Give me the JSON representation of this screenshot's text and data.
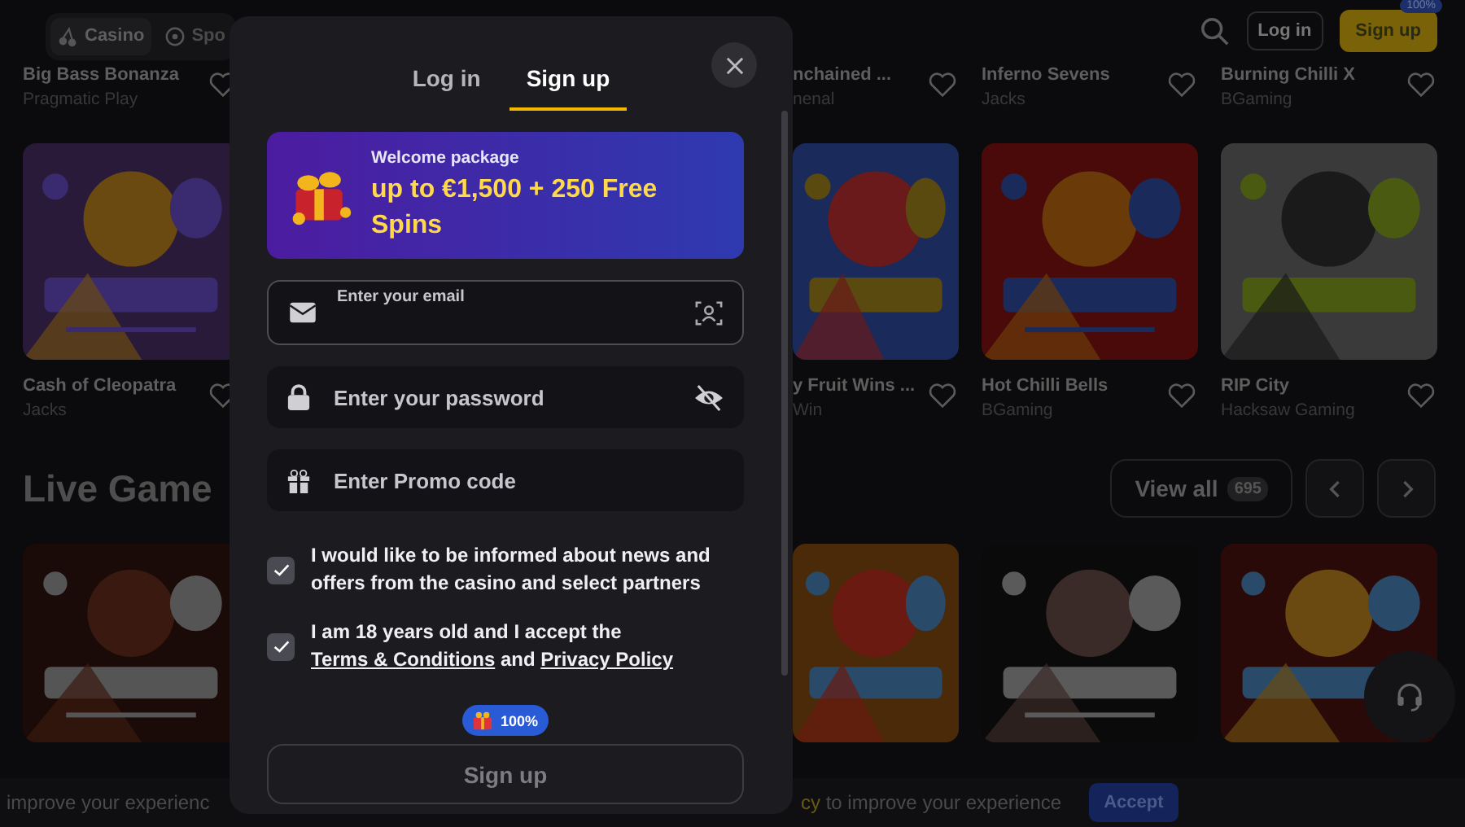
{
  "header": {
    "nav_tabs": [
      {
        "label": "Casino",
        "selected": true
      },
      {
        "label": "Spo",
        "selected": false
      }
    ],
    "login_button": "Log in",
    "signup_button": "Sign up",
    "signup_badge": "100%"
  },
  "top_row": [
    {
      "title": "Big Bass Bonanza",
      "provider": "Pragmatic Play"
    },
    {
      "title": "nchained ...",
      "provider": "nenal"
    },
    {
      "title": "Inferno Sevens",
      "provider": "Jacks"
    },
    {
      "title": "Burning Chilli X",
      "provider": "BGaming"
    }
  ],
  "games": [
    {
      "kind": "picture",
      "title": "Cash of Cleopatra",
      "provider": "Jacks"
    },
    {
      "kind": "picture",
      "title": "y Fruit Wins ...",
      "provider": "Win"
    },
    {
      "kind": "picture",
      "title": "Hot Chilli Bells",
      "provider": "BGaming"
    },
    {
      "kind": "picture",
      "title": "RIP City",
      "provider": "Hacksaw Gaming"
    }
  ],
  "live_section": {
    "title": "Live Game",
    "view_all": "View all",
    "count": "695"
  },
  "cookie_bar": {
    "text_left": "improve your experienc",
    "link": "cy",
    "text_right": "to improve your experience",
    "accept": "Accept"
  },
  "modal": {
    "tabs": [
      {
        "label": "Log in",
        "selected": false
      },
      {
        "label": "Sign up",
        "selected": true
      }
    ],
    "banner": {
      "title": "Welcome package",
      "offer": "up to €1,500 + 250 Free Spins"
    },
    "fields": [
      {
        "kind": "email",
        "label": "Enter your email"
      },
      {
        "kind": "password",
        "placeholder": "Enter your password"
      },
      {
        "kind": "promo",
        "placeholder": "Enter Promo code"
      }
    ],
    "consents": [
      {
        "checked": true,
        "text": "I would like to be informed about news and offers from the casino and select partners"
      },
      {
        "checked": true,
        "text": "I am 18 years old and I accept the",
        "links": [
          "Terms & Conditions",
          "Privacy Policy"
        ],
        "joiner": "and"
      }
    ],
    "bonus_badge": "100%",
    "submit": "Sign up"
  }
}
